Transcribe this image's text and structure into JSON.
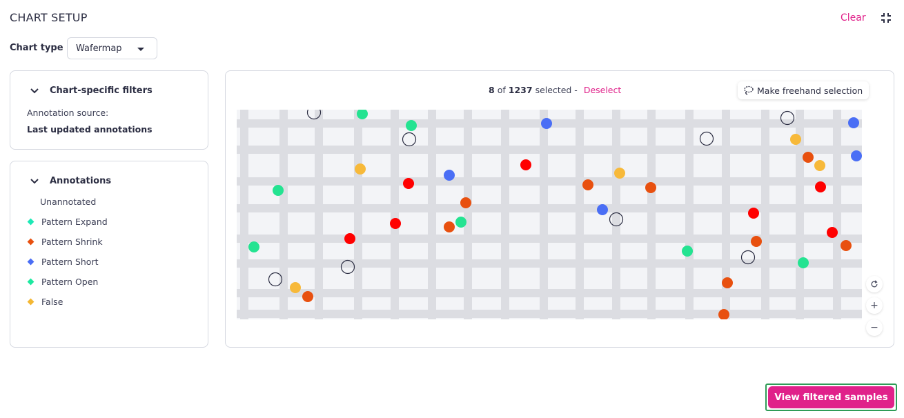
{
  "header": {
    "title": "CHART SETUP",
    "clear_label": "Clear",
    "collapse_icon": "collapse-icon"
  },
  "chart_type": {
    "label": "Chart type",
    "selected": "Wafermap"
  },
  "filters_panel": {
    "title": "Chart-specific filters",
    "source_label": "Annotation source:",
    "source_value": "Last updated annotations"
  },
  "annotations_panel": {
    "title": "Annotations",
    "items": [
      {
        "label": "Unannotated",
        "color": null
      },
      {
        "label": "Pattern Expand",
        "color": "#1de9b6"
      },
      {
        "label": "Pattern Shrink",
        "color": "#e8500f"
      },
      {
        "label": "Pattern Short",
        "color": "#4a6ef5"
      },
      {
        "label": "Pattern Open",
        "color": "#1de9a0"
      },
      {
        "label": "False",
        "color": "#f4b733"
      }
    ]
  },
  "chart": {
    "selected_count": "8",
    "of_text": "of",
    "total_count": "1237",
    "selected_text": "selected -",
    "deselect_label": "Deselect",
    "freehand_label": "Make freehand selection",
    "colors": {
      "expand": "#24e391",
      "shrink": "#e8500f",
      "short": "#4a6ef5",
      "open": "#ff0000",
      "false": "#f7b93a",
      "selected_ring": "#2b2d42",
      "grid_line": "#dcdde2",
      "die": "#f3f4f7"
    }
  },
  "view_button": {
    "label": "View filtered samples"
  }
}
